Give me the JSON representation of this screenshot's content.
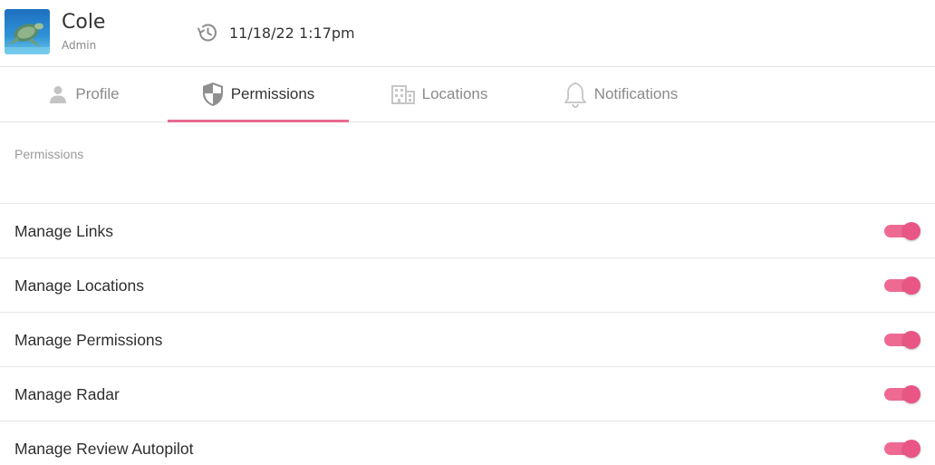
{
  "user": {
    "name": "Cole",
    "role": "Admin"
  },
  "last_activity": "11/18/22 1:17pm",
  "tabs": [
    {
      "label": "Profile",
      "icon": "person-icon",
      "active": false
    },
    {
      "label": "Permissions",
      "icon": "shield-icon",
      "active": true
    },
    {
      "label": "Locations",
      "icon": "building-icon",
      "active": false
    },
    {
      "label": "Notifications",
      "icon": "bell-icon",
      "active": false
    }
  ],
  "section": {
    "title": "Permissions"
  },
  "permissions": [
    {
      "label": "Manage Links",
      "enabled": true
    },
    {
      "label": "Manage Locations",
      "enabled": true
    },
    {
      "label": "Manage Permissions",
      "enabled": true
    },
    {
      "label": "Manage Radar",
      "enabled": true
    },
    {
      "label": "Manage Review Autopilot",
      "enabled": true
    }
  ],
  "colors": {
    "accent": "#e96a91",
    "toggle_track": "#ef6a93",
    "toggle_thumb": "#e95585"
  }
}
